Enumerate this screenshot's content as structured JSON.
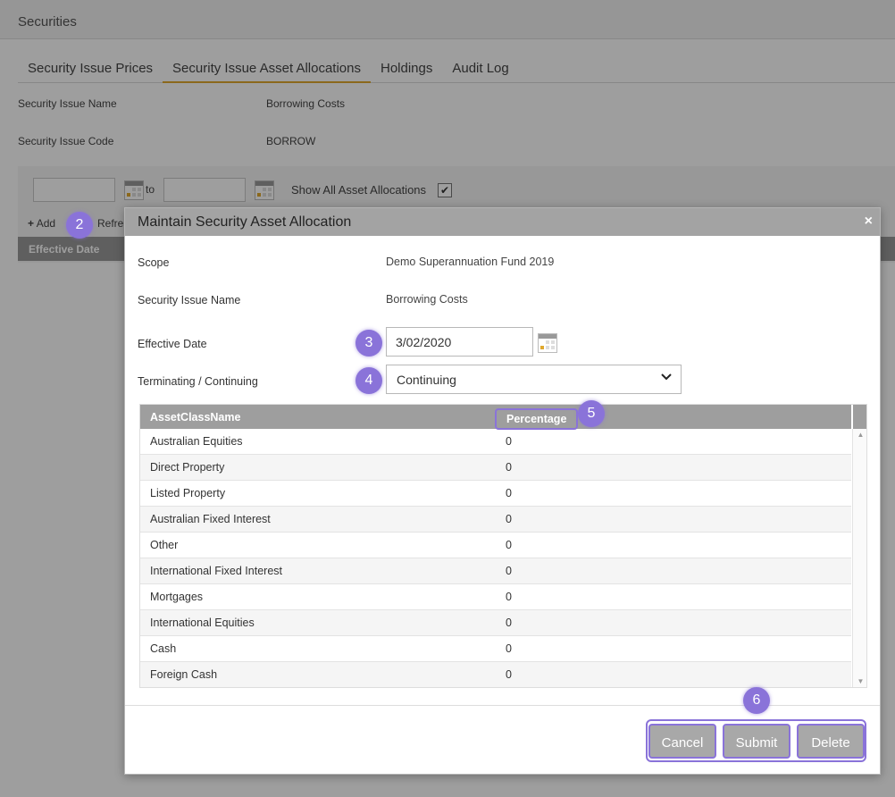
{
  "page": {
    "header_title": "Securities",
    "tabs": [
      "Security Issue Prices",
      "Security Issue Asset Allocations",
      "Holdings",
      "Audit Log"
    ],
    "info": [
      {
        "label": "Security Issue Name",
        "value": "Borrowing Costs"
      },
      {
        "label": "Security Issue Code",
        "value": "BORROW"
      }
    ],
    "filter": {
      "to_label": "to",
      "show_all_label": "Show All Asset Allocations",
      "show_all_checked": "✔",
      "add_label": "Add",
      "refresh_label": "Refre"
    },
    "grid_header": "Effective Date"
  },
  "modal": {
    "title": "Maintain Security Asset Allocation",
    "close_glyph": "×",
    "fields": {
      "scope_label": "Scope",
      "scope_value": "Demo Superannuation Fund 2019",
      "name_label": "Security Issue Name",
      "name_value": "Borrowing Costs",
      "date_label": "Effective Date",
      "date_value": "3/02/2020",
      "term_label": "Terminating / Continuing",
      "term_value": "Continuing"
    },
    "table": {
      "headers": [
        "AssetClassName",
        "Percentage"
      ],
      "rows": [
        {
          "name": "Australian Equities",
          "pct": "0"
        },
        {
          "name": "Direct Property",
          "pct": "0"
        },
        {
          "name": "Listed Property",
          "pct": "0"
        },
        {
          "name": "Australian Fixed Interest",
          "pct": "0"
        },
        {
          "name": "Other",
          "pct": "0"
        },
        {
          "name": "International Fixed Interest",
          "pct": "0"
        },
        {
          "name": "Mortgages",
          "pct": "0"
        },
        {
          "name": "International Equities",
          "pct": "0"
        },
        {
          "name": "Cash",
          "pct": "0"
        },
        {
          "name": "Foreign Cash",
          "pct": "0"
        }
      ]
    },
    "buttons": {
      "cancel": "Cancel",
      "submit": "Submit",
      "delete": "Delete"
    }
  },
  "badges": [
    "2",
    "3",
    "4",
    "5",
    "6"
  ],
  "colors": {
    "accent": "#8a73d9",
    "tab_underline": "#e0a82e",
    "header_gray": "#9e9e9e"
  }
}
